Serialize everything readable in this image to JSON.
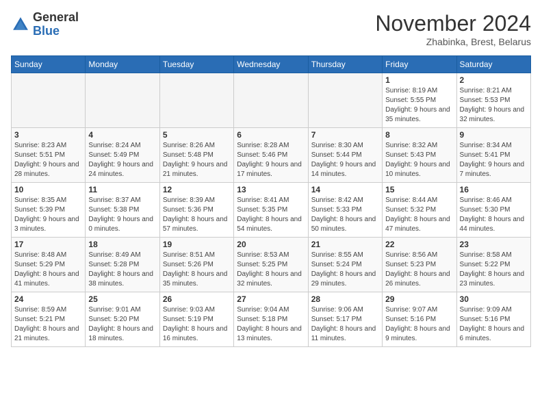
{
  "header": {
    "logo_general": "General",
    "logo_blue": "Blue",
    "month_title": "November 2024",
    "subtitle": "Zhabinka, Brest, Belarus"
  },
  "columns": [
    "Sunday",
    "Monday",
    "Tuesday",
    "Wednesday",
    "Thursday",
    "Friday",
    "Saturday"
  ],
  "weeks": [
    [
      {
        "day": "",
        "info": ""
      },
      {
        "day": "",
        "info": ""
      },
      {
        "day": "",
        "info": ""
      },
      {
        "day": "",
        "info": ""
      },
      {
        "day": "",
        "info": ""
      },
      {
        "day": "1",
        "info": "Sunrise: 8:19 AM\nSunset: 5:55 PM\nDaylight: 9 hours and 35 minutes."
      },
      {
        "day": "2",
        "info": "Sunrise: 8:21 AM\nSunset: 5:53 PM\nDaylight: 9 hours and 32 minutes."
      }
    ],
    [
      {
        "day": "3",
        "info": "Sunrise: 8:23 AM\nSunset: 5:51 PM\nDaylight: 9 hours and 28 minutes."
      },
      {
        "day": "4",
        "info": "Sunrise: 8:24 AM\nSunset: 5:49 PM\nDaylight: 9 hours and 24 minutes."
      },
      {
        "day": "5",
        "info": "Sunrise: 8:26 AM\nSunset: 5:48 PM\nDaylight: 9 hours and 21 minutes."
      },
      {
        "day": "6",
        "info": "Sunrise: 8:28 AM\nSunset: 5:46 PM\nDaylight: 9 hours and 17 minutes."
      },
      {
        "day": "7",
        "info": "Sunrise: 8:30 AM\nSunset: 5:44 PM\nDaylight: 9 hours and 14 minutes."
      },
      {
        "day": "8",
        "info": "Sunrise: 8:32 AM\nSunset: 5:43 PM\nDaylight: 9 hours and 10 minutes."
      },
      {
        "day": "9",
        "info": "Sunrise: 8:34 AM\nSunset: 5:41 PM\nDaylight: 9 hours and 7 minutes."
      }
    ],
    [
      {
        "day": "10",
        "info": "Sunrise: 8:35 AM\nSunset: 5:39 PM\nDaylight: 9 hours and 3 minutes."
      },
      {
        "day": "11",
        "info": "Sunrise: 8:37 AM\nSunset: 5:38 PM\nDaylight: 9 hours and 0 minutes."
      },
      {
        "day": "12",
        "info": "Sunrise: 8:39 AM\nSunset: 5:36 PM\nDaylight: 8 hours and 57 minutes."
      },
      {
        "day": "13",
        "info": "Sunrise: 8:41 AM\nSunset: 5:35 PM\nDaylight: 8 hours and 54 minutes."
      },
      {
        "day": "14",
        "info": "Sunrise: 8:42 AM\nSunset: 5:33 PM\nDaylight: 8 hours and 50 minutes."
      },
      {
        "day": "15",
        "info": "Sunrise: 8:44 AM\nSunset: 5:32 PM\nDaylight: 8 hours and 47 minutes."
      },
      {
        "day": "16",
        "info": "Sunrise: 8:46 AM\nSunset: 5:30 PM\nDaylight: 8 hours and 44 minutes."
      }
    ],
    [
      {
        "day": "17",
        "info": "Sunrise: 8:48 AM\nSunset: 5:29 PM\nDaylight: 8 hours and 41 minutes."
      },
      {
        "day": "18",
        "info": "Sunrise: 8:49 AM\nSunset: 5:28 PM\nDaylight: 8 hours and 38 minutes."
      },
      {
        "day": "19",
        "info": "Sunrise: 8:51 AM\nSunset: 5:26 PM\nDaylight: 8 hours and 35 minutes."
      },
      {
        "day": "20",
        "info": "Sunrise: 8:53 AM\nSunset: 5:25 PM\nDaylight: 8 hours and 32 minutes."
      },
      {
        "day": "21",
        "info": "Sunrise: 8:55 AM\nSunset: 5:24 PM\nDaylight: 8 hours and 29 minutes."
      },
      {
        "day": "22",
        "info": "Sunrise: 8:56 AM\nSunset: 5:23 PM\nDaylight: 8 hours and 26 minutes."
      },
      {
        "day": "23",
        "info": "Sunrise: 8:58 AM\nSunset: 5:22 PM\nDaylight: 8 hours and 23 minutes."
      }
    ],
    [
      {
        "day": "24",
        "info": "Sunrise: 8:59 AM\nSunset: 5:21 PM\nDaylight: 8 hours and 21 minutes."
      },
      {
        "day": "25",
        "info": "Sunrise: 9:01 AM\nSunset: 5:20 PM\nDaylight: 8 hours and 18 minutes."
      },
      {
        "day": "26",
        "info": "Sunrise: 9:03 AM\nSunset: 5:19 PM\nDaylight: 8 hours and 16 minutes."
      },
      {
        "day": "27",
        "info": "Sunrise: 9:04 AM\nSunset: 5:18 PM\nDaylight: 8 hours and 13 minutes."
      },
      {
        "day": "28",
        "info": "Sunrise: 9:06 AM\nSunset: 5:17 PM\nDaylight: 8 hours and 11 minutes."
      },
      {
        "day": "29",
        "info": "Sunrise: 9:07 AM\nSunset: 5:16 PM\nDaylight: 8 hours and 9 minutes."
      },
      {
        "day": "30",
        "info": "Sunrise: 9:09 AM\nSunset: 5:16 PM\nDaylight: 8 hours and 6 minutes."
      }
    ]
  ]
}
